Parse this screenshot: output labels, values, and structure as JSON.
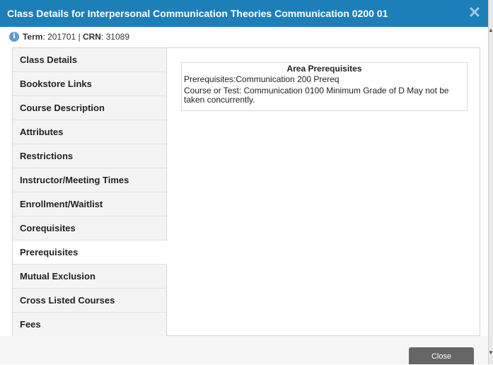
{
  "dialog": {
    "title": "Class Details for Interpersonal Communication Theories Communication 0200 01",
    "close_icon": "close-icon"
  },
  "term": {
    "term_label": "Term",
    "term_value": ": 201701 | ",
    "crn_label": "CRN",
    "crn_value": ": 31089"
  },
  "sidebar": {
    "items": [
      {
        "label": "Class Details"
      },
      {
        "label": "Bookstore Links"
      },
      {
        "label": "Course Description"
      },
      {
        "label": "Attributes"
      },
      {
        "label": "Restrictions"
      },
      {
        "label": "Instructor/Meeting Times"
      },
      {
        "label": "Enrollment/Waitlist"
      },
      {
        "label": "Corequisites"
      },
      {
        "label": "Prerequisites",
        "active": true
      },
      {
        "label": "Mutual Exclusion"
      },
      {
        "label": "Cross Listed Courses"
      },
      {
        "label": "Fees"
      }
    ]
  },
  "content": {
    "area_title": "Area Prerequisites",
    "prereq_line": "Prerequisites:Communication 200 Prereq",
    "prereq_detail": "Course or Test: Communication 0100 Minimum Grade of D May not be taken concurrently."
  },
  "footer": {
    "close_label": "Close"
  }
}
